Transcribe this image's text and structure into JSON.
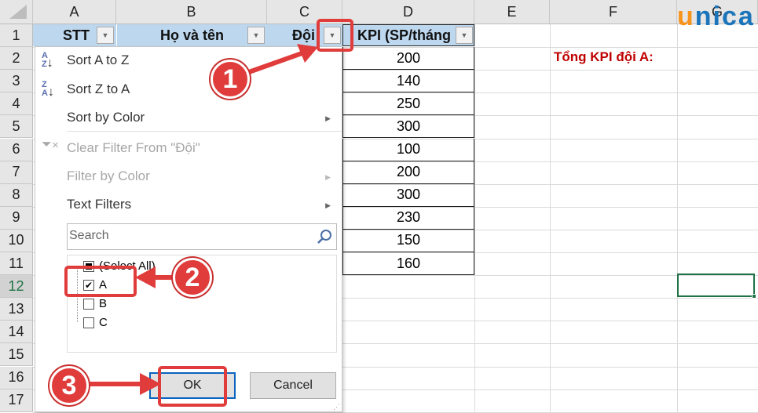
{
  "columns": [
    "A",
    "B",
    "C",
    "D",
    "E",
    "F",
    "G"
  ],
  "rows": [
    "1",
    "2",
    "3",
    "4",
    "5",
    "6",
    "7",
    "8",
    "9",
    "10",
    "11",
    "12",
    "13",
    "14",
    "15",
    "16",
    "17"
  ],
  "headers": {
    "stt": "STT",
    "name": "Họ và tên",
    "team": "Đội",
    "kpi": "KPI (SP/tháng"
  },
  "kpi_values": [
    "200",
    "140",
    "250",
    "300",
    "100",
    "200",
    "300",
    "230",
    "150",
    "160"
  ],
  "summary_label": "Tổng KPI đội A:",
  "logo": "unica",
  "menu": {
    "sort_az": "Sort A to Z",
    "sort_za": "Sort Z to A",
    "sort_color": "Sort by Color",
    "clear_filter": "Clear Filter From \"Đội\"",
    "filter_color": "Filter by Color",
    "text_filters": "Text Filters",
    "search_placeholder": "Search",
    "items": [
      {
        "label": "(Select All)",
        "state": "partial"
      },
      {
        "label": "A",
        "state": "checked"
      },
      {
        "label": "B",
        "state": "unchecked"
      },
      {
        "label": "C",
        "state": "unchecked"
      }
    ],
    "ok": "OK",
    "cancel": "Cancel"
  },
  "callouts": [
    "1",
    "2",
    "3"
  ],
  "colors": {
    "header_fill": "#bdd7ee",
    "accent_red": "#e03c3c",
    "summary_text": "#c00000",
    "logo_orange": "#f7941d",
    "logo_blue": "#1a75bb"
  }
}
